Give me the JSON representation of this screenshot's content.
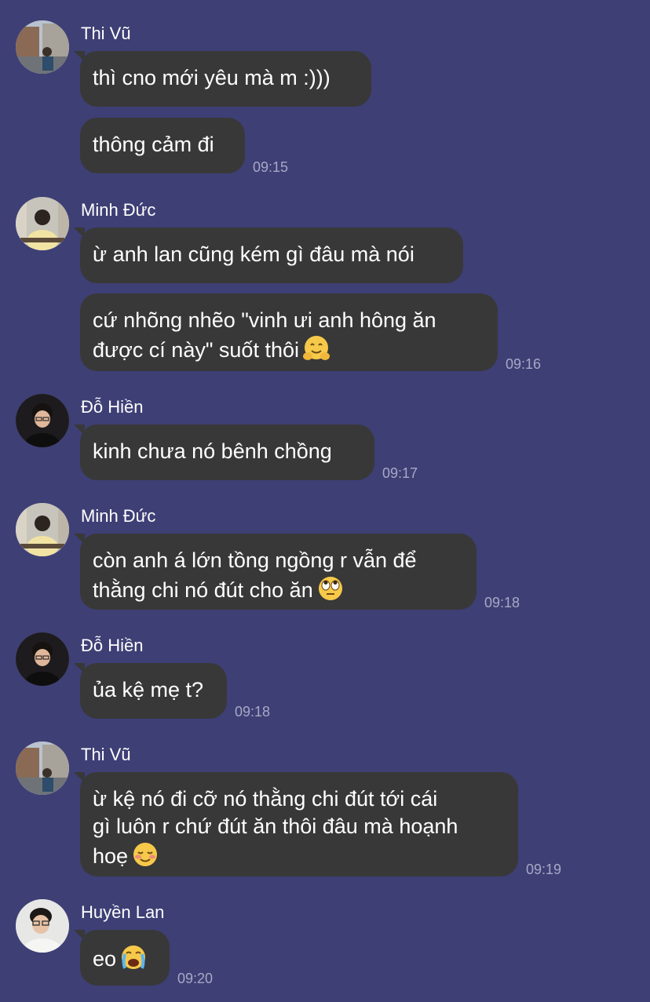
{
  "colors": {
    "background": "#3e3f75",
    "bubble": "#383838",
    "text": "#ffffff",
    "timestamp": "#a7a9c6"
  },
  "messages": [
    {
      "sender": "Thi Vũ",
      "avatar": "avatar-thi-vu",
      "bubbles": [
        {
          "lines": [
            "thì cno mới yêu mà m :)))"
          ]
        },
        {
          "lines": [
            "thông cảm đi"
          ],
          "time": "09:15"
        }
      ]
    },
    {
      "sender": "Minh Đức",
      "avatar": "avatar-minh-duc",
      "bubbles": [
        {
          "lines": [
            "ừ anh lan cũng kém gì đâu mà nói"
          ]
        },
        {
          "lines": [
            "cứ nhõng nhẽo \"vinh ưi anh hông ăn",
            "được cí này\" suốt thôi"
          ],
          "emoji": "hugging-face-emoji",
          "time": "09:16"
        }
      ]
    },
    {
      "sender": "Đỗ Hiền",
      "avatar": "avatar-do-hien",
      "bubbles": [
        {
          "lines": [
            "kinh chưa nó bênh chồng"
          ],
          "time": "09:17"
        }
      ]
    },
    {
      "sender": "Minh Đức",
      "avatar": "avatar-minh-duc",
      "bubbles": [
        {
          "lines": [
            "còn anh á lớn tồng ngồng r vẫn để",
            "thằng chi nó đút cho ăn"
          ],
          "emoji": "eye-roll-emoji",
          "time": "09:18"
        }
      ]
    },
    {
      "sender": "Đỗ Hiền",
      "avatar": "avatar-do-hien",
      "bubbles": [
        {
          "lines": [
            "ủa kệ mẹ t?"
          ],
          "time": "09:18"
        }
      ]
    },
    {
      "sender": "Thi Vũ",
      "avatar": "avatar-thi-vu",
      "bubbles": [
        {
          "lines": [
            "ừ kệ nó đi cỡ nó thằng chi đút tới cái",
            "gì luôn r chứ đút ăn thôi đâu mà hoạnh",
            "hoẹ"
          ],
          "emoji": "smiling-blush-emoji",
          "time": "09:19"
        }
      ]
    },
    {
      "sender": "Huyền Lan",
      "avatar": "avatar-huyen-lan",
      "bubbles": [
        {
          "lines": [
            "eo"
          ],
          "emoji": "loudly-crying-emoji",
          "time": "09:20"
        }
      ]
    }
  ]
}
